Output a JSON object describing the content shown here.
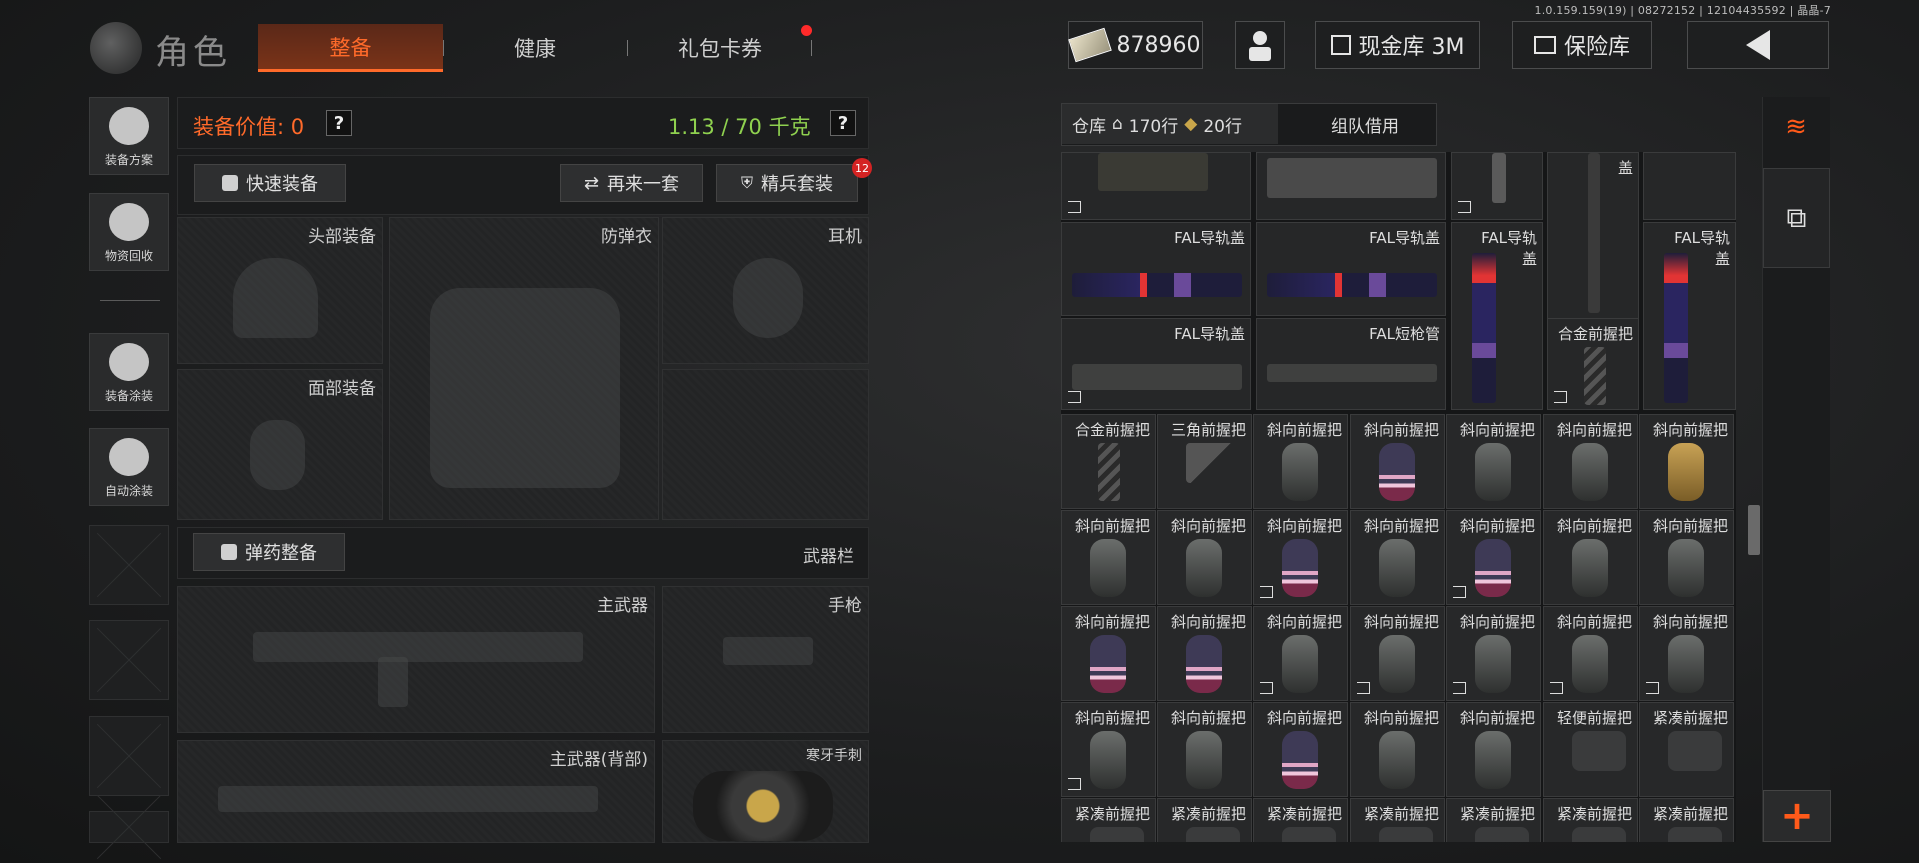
{
  "version_text": "1.0.159.159(19) | 08272152 | 12104435592 | 晶晶-7",
  "header": {
    "title": "角色",
    "tabs": [
      {
        "label": "整备",
        "active": true
      },
      {
        "label": "健康",
        "active": false
      },
      {
        "label": "礼包卡券",
        "active": false
      }
    ],
    "cash": "878960",
    "cash_vault": "现金库 3M",
    "safe": "保险库"
  },
  "sidebar": {
    "items": [
      {
        "label": "装备方案",
        "icon": "helmet-grid-icon"
      },
      {
        "label": "物资回收",
        "icon": "recycle-bag-icon"
      },
      {
        "label": "装备涂装",
        "icon": "helmet-brush-icon"
      },
      {
        "label": "自动涂装",
        "icon": "brush-gear-icon"
      }
    ]
  },
  "equipment": {
    "value_label": "装备价值: 0",
    "help": "?",
    "weight": "1.13 / 70 千克",
    "quick_equip": "快速装备",
    "again": "再来一套",
    "elite": "精兵套装",
    "elite_badge": "12",
    "slots": {
      "head": "头部装备",
      "armor": "防弹衣",
      "headset": "耳机",
      "face": "面部装备",
      "primary": "主武器",
      "pistol": "手枪",
      "primary_back": "主武器(背部)",
      "melee": "寒牙手刺"
    },
    "ammo_button": "弹药整备",
    "weapon_bar": "武器栏"
  },
  "inventory": {
    "tab_label": "仓库",
    "rows_label": "170行",
    "rows2_label": "20行",
    "team_borrow": "组队借用",
    "top_partial": {
      "label": "盖"
    },
    "fal_items": [
      {
        "label": "FAL导轨盖"
      },
      {
        "label": "FAL导轨盖"
      },
      {
        "label": "FAL导轨\n盖"
      },
      {
        "label": "FAL导轨\n盖"
      },
      {
        "label": "FAL导轨盖"
      },
      {
        "label": "FAL短枪管"
      },
      {
        "label": "合金前握把"
      }
    ],
    "grid": [
      [
        "合金前握把",
        "三角前握把",
        "斜向前握把",
        "斜向前握把",
        "斜向前握把",
        "斜向前握把",
        "斜向前握把"
      ],
      [
        "斜向前握把",
        "斜向前握把",
        "斜向前握把",
        "斜向前握把",
        "斜向前握把",
        "斜向前握把",
        "斜向前握把"
      ],
      [
        "斜向前握把",
        "斜向前握把",
        "斜向前握把",
        "斜向前握把",
        "斜向前握把",
        "斜向前握把",
        "斜向前握把"
      ],
      [
        "斜向前握把",
        "斜向前握把",
        "斜向前握把",
        "斜向前握把",
        "斜向前握把",
        "轻便前握把",
        "紧凑前握把"
      ],
      [
        "紧凑前握把",
        "紧凑前握把",
        "紧凑前握把",
        "紧凑前握把",
        "紧凑前握把",
        "紧凑前握把",
        "紧凑前握把"
      ]
    ],
    "grid_art": [
      [
        "rib",
        "tri",
        "grey",
        "pink",
        "grey",
        "grey",
        "gold"
      ],
      [
        "grey",
        "grey",
        "pink",
        "grey",
        "pink",
        "grey",
        "grey"
      ],
      [
        "pink",
        "pink",
        "grey",
        "grey",
        "grey",
        "grey",
        "grey"
      ],
      [
        "grey",
        "grey",
        "pink",
        "grey",
        "grey",
        "comp",
        "comp"
      ],
      [
        "comp",
        "comp",
        "comp",
        "comp",
        "comp",
        "comp",
        "comp"
      ]
    ],
    "share_rows": [
      [
        false,
        false,
        false,
        false,
        false,
        false,
        false
      ],
      [
        false,
        false,
        true,
        false,
        true,
        false,
        false
      ],
      [
        false,
        false,
        true,
        true,
        true,
        true,
        true
      ],
      [
        true,
        false,
        false,
        false,
        false,
        false,
        false
      ],
      [
        false,
        false,
        false,
        false,
        false,
        false,
        false
      ]
    ]
  },
  "accent_color": "#ff6a2a",
  "weight_color": "#8fd14f"
}
